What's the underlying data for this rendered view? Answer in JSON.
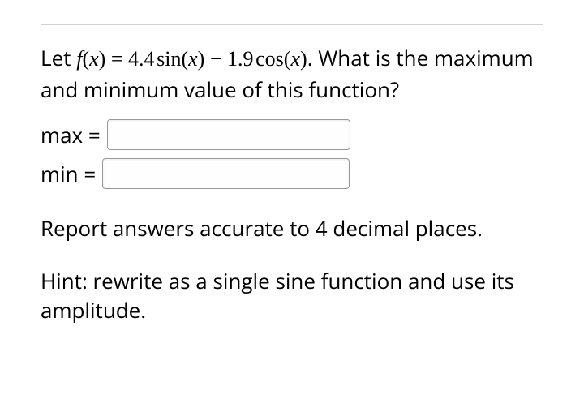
{
  "question": {
    "prefix": "Let ",
    "fn_name": "f",
    "open_p": "(",
    "var": "x",
    "close_p": ")",
    "eq": " = ",
    "coef_a": "4.4",
    "trig_a": "sin",
    "minus": " − ",
    "coef_b": "1.9",
    "trig_b": "cos",
    "suffix": ". What is the maximum and minimum value of this function?"
  },
  "inputs": {
    "max_label": "max =",
    "min_label": "min =",
    "max_value": "",
    "min_value": ""
  },
  "instruction": "Report answers accurate to 4 decimal places.",
  "hint": "Hint: rewrite as a single sine function and use its amplitude."
}
